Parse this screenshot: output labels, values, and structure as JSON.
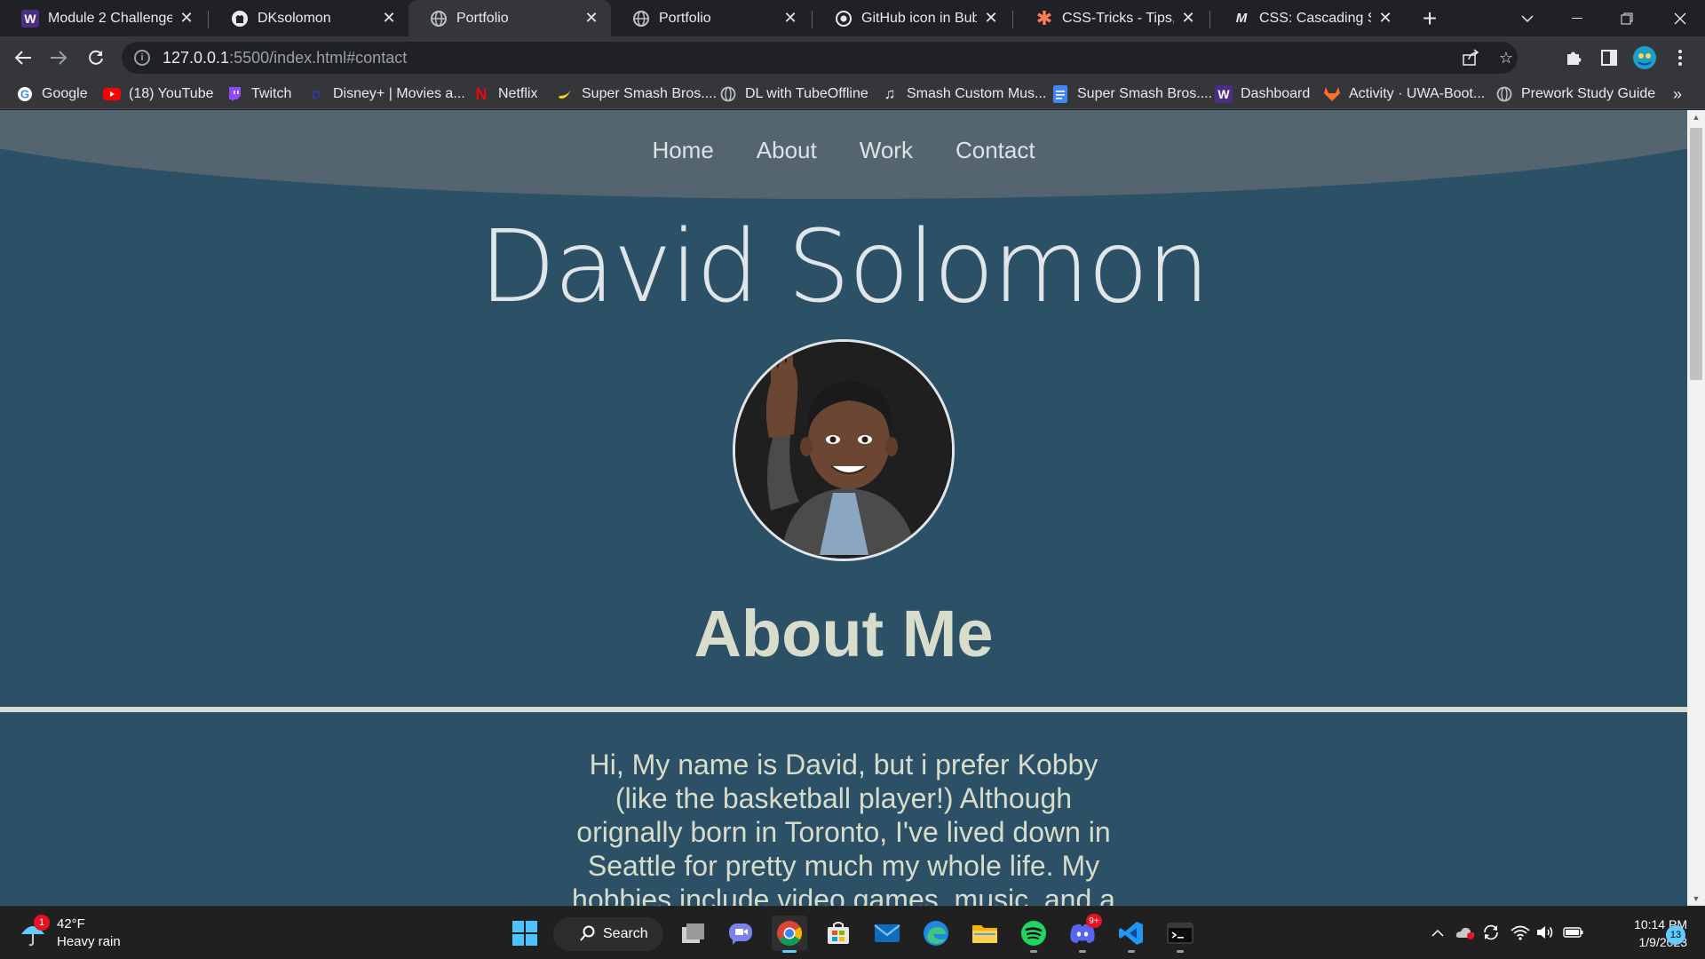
{
  "tabs": [
    {
      "title": "Module 2 Challenge",
      "icon": "w-icon",
      "close": "✕"
    },
    {
      "title": "DKsolomon",
      "icon": "github-icon",
      "close": "✕"
    },
    {
      "title": "Portfolio",
      "icon": "globe-icon",
      "close": "✕",
      "active": true
    },
    {
      "title": "Portfolio",
      "icon": "globe-icon",
      "close": "✕"
    },
    {
      "title": "GitHub icon in Bubble",
      "icon": "github-icon",
      "close": "✕"
    },
    {
      "title": "CSS-Tricks - Tips, Tricks",
      "icon": "asterisk-icon",
      "close": "✕"
    },
    {
      "title": "CSS: Cascading Style Sheets",
      "icon": "mdn-icon",
      "close": "✕"
    }
  ],
  "new_tab": "+",
  "address": {
    "host": "127.0.0.1",
    "path": ":5500/index.html#contact"
  },
  "bookmarks": [
    {
      "label": "Google",
      "icon": "google-icon"
    },
    {
      "label": "(18) YouTube",
      "icon": "youtube-icon"
    },
    {
      "label": "Twitch",
      "icon": "twitch-icon"
    },
    {
      "label": "Disney+ | Movies a...",
      "icon": "disney-icon"
    },
    {
      "label": "Netflix",
      "icon": "netflix-icon"
    },
    {
      "label": "Super Smash Bros....",
      "icon": "banana-icon"
    },
    {
      "label": "DL with TubeOffline",
      "icon": "globe-icon"
    },
    {
      "label": "Smash Custom Mus...",
      "icon": "music-note-icon"
    },
    {
      "label": "Super Smash Bros....",
      "icon": "doc-icon"
    },
    {
      "label": "Dashboard",
      "icon": "w-icon"
    },
    {
      "label": "Activity · UWA-Boot...",
      "icon": "gitlab-icon"
    },
    {
      "label": "Prework Study Guide",
      "icon": "globe-icon"
    }
  ],
  "bookmarks_more": "»",
  "page": {
    "nav": [
      "Home",
      "About",
      "Work",
      "Contact"
    ],
    "name": "David Solomon",
    "about_heading": "About Me",
    "about_text": "Hi, My name is David, but i prefer Kobby (like the basketball player!) Although orignally born in Toronto, I've lived down in Seattle for pretty much my whole life. My hobbies include video games, music, and a little bit of"
  },
  "taskbar": {
    "weather": {
      "temp": "42°F",
      "desc": "Heavy rain",
      "badge": "1"
    },
    "search_label": "Search",
    "apps": [
      "windows-start-icon",
      "task-view-icon",
      "teams-chat-icon",
      "chrome-icon",
      "store-icon",
      "mail-icon",
      "edge-icon",
      "file-explorer-icon",
      "spotify-icon",
      "discord-icon",
      "vscode-icon",
      "terminal-icon"
    ],
    "discord_badge": "9+",
    "time": "10:14 PM",
    "date": "1/9/2023",
    "notifications": "13"
  },
  "colors": {
    "page_bg": "#2c5066",
    "nav_band": "#54656f",
    "accent_text": "#d8dccb",
    "chrome_dark": "#202124",
    "chrome_toolbar": "#35363a"
  }
}
